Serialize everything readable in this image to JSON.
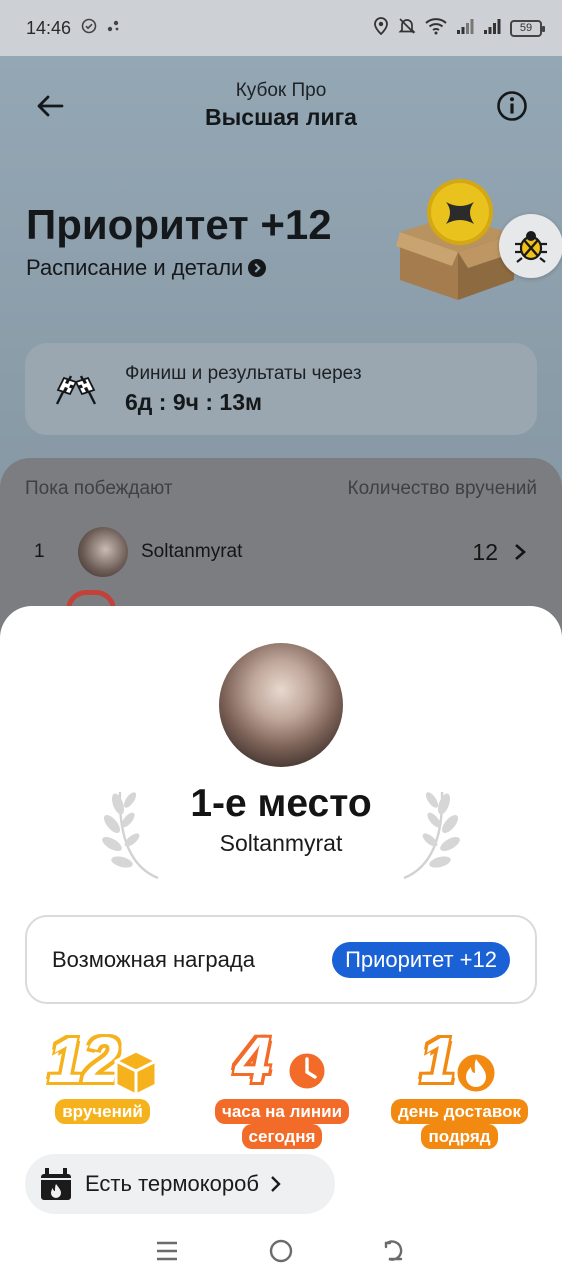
{
  "status_bar": {
    "time": "14:46",
    "battery": "59",
    "icons": [
      "check-circle-icon",
      "dots-icon",
      "location-icon",
      "bell-off-icon",
      "wifi-icon",
      "signal-icon",
      "signal-icon",
      "battery-icon"
    ]
  },
  "header": {
    "subtitle": "Кубок Про",
    "title": "Высшая лига"
  },
  "hero": {
    "title": "Приоритет +12",
    "link": "Расписание и детали"
  },
  "finish": {
    "label": "Финиш и результаты через",
    "value": "6д : 9ч : 13м"
  },
  "leaderboard": {
    "left_header": "Пока побеждают",
    "right_header": "Количество вручений",
    "rows": [
      {
        "rank": "1",
        "name": "Soltanmyrat",
        "count": "12"
      }
    ]
  },
  "sheet": {
    "place": "1-е место",
    "name": "Soltanmyrat",
    "reward_label": "Возможная награда",
    "reward_badge": "Приоритет +12",
    "achievements": [
      {
        "value": "12",
        "caption_line1": "вручений",
        "caption_line2": "",
        "color": "#f6b21c"
      },
      {
        "value": "4",
        "caption_line1": "часа на линии",
        "caption_line2": "сегодня",
        "color": "#f26b28"
      },
      {
        "value": "1",
        "caption_line1": "день доставок",
        "caption_line2": "подряд",
        "color": "#f28a12"
      }
    ],
    "thermo_label": "Есть термокороб"
  },
  "colors": {
    "accent_blue": "#1b61d6",
    "yellow": "#f6b21c",
    "orange_red": "#f26b28",
    "orange": "#f28a12"
  }
}
